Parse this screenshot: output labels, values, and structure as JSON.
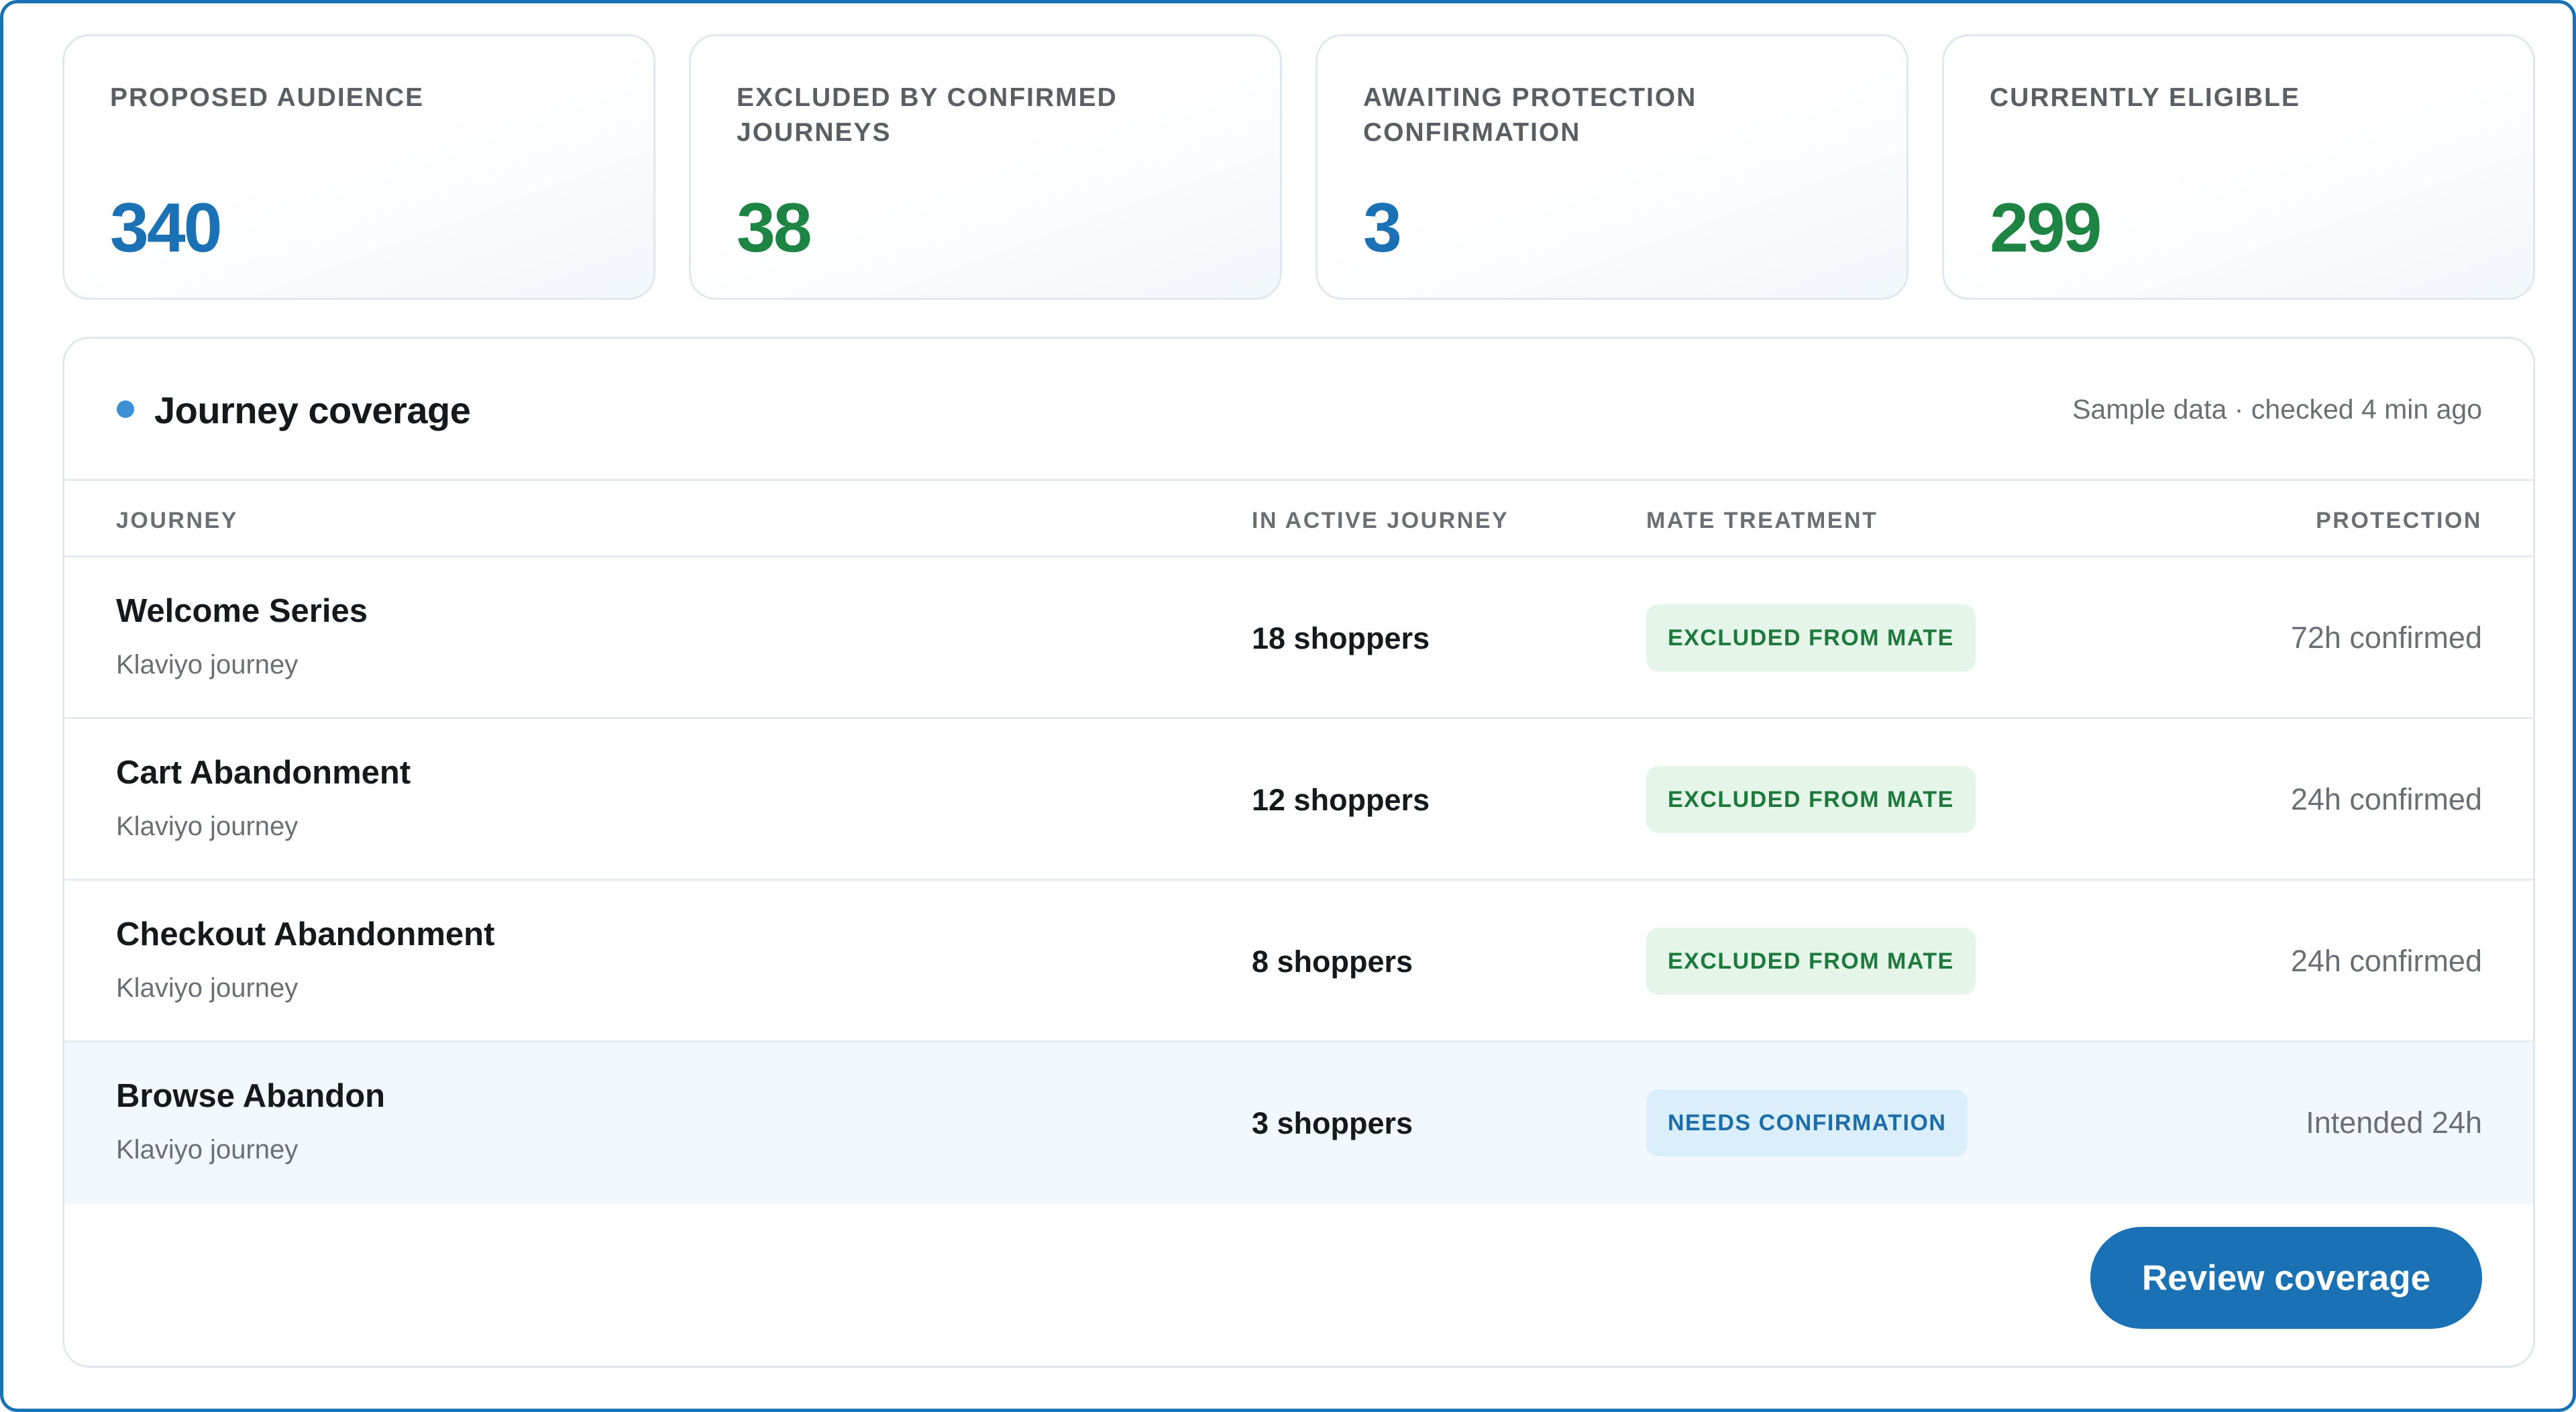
{
  "colors": {
    "accent_blue": "#1a72b5",
    "value_blue": "#1a72b5",
    "value_green": "#1e8443",
    "badge_green_bg": "#e6f5ea",
    "badge_green_text": "#1d7a3c",
    "badge_blue_bg": "#dbeefb",
    "badge_blue_text": "#1d6ea8"
  },
  "stats": [
    {
      "label": "PROPOSED AUDIENCE",
      "value": "340",
      "tone": "blue"
    },
    {
      "label": "EXCLUDED BY CONFIRMED JOURNEYS",
      "value": "38",
      "tone": "green"
    },
    {
      "label": "AWAITING PROTECTION CONFIRMATION",
      "value": "3",
      "tone": "blue"
    },
    {
      "label": "CURRENTLY ELIGIBLE",
      "value": "299",
      "tone": "green"
    }
  ],
  "coverage": {
    "title": "Journey coverage",
    "meta": "Sample data · checked 4 min ago",
    "columns": {
      "journey": "JOURNEY",
      "active": "IN ACTIVE JOURNEY",
      "treatment": "MATE TREATMENT",
      "protection": "PROTECTION"
    },
    "rows": [
      {
        "name": "Welcome Series",
        "type": "Klaviyo journey",
        "count": "18 shoppers",
        "treatment": "EXCLUDED FROM MATE",
        "protection": "72h confirmed"
      },
      {
        "name": "Cart Abandonment",
        "type": "Klaviyo journey",
        "count": "12 shoppers",
        "treatment": "EXCLUDED FROM MATE",
        "protection": "24h confirmed"
      },
      {
        "name": "Checkout Abandonment",
        "type": "Klaviyo journey",
        "count": "8 shoppers",
        "treatment": "EXCLUDED FROM MATE",
        "protection": "24h confirmed"
      },
      {
        "name": "Browse Abandon",
        "type": "Klaviyo journey",
        "count": "3 shoppers",
        "treatment": "NEEDS CONFIRMATION",
        "protection": "Intended 24h"
      }
    ],
    "review_label": "Review coverage"
  }
}
